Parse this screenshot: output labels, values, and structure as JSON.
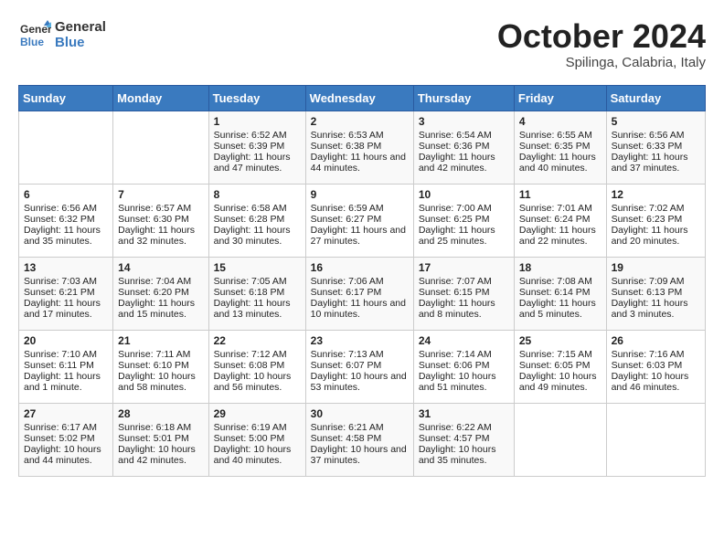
{
  "header": {
    "logo_line1": "General",
    "logo_line2": "Blue",
    "month": "October 2024",
    "location": "Spilinga, Calabria, Italy"
  },
  "days_of_week": [
    "Sunday",
    "Monday",
    "Tuesday",
    "Wednesday",
    "Thursday",
    "Friday",
    "Saturday"
  ],
  "weeks": [
    [
      {
        "day": "",
        "content": ""
      },
      {
        "day": "",
        "content": ""
      },
      {
        "day": "1",
        "content": "Sunrise: 6:52 AM\nSunset: 6:39 PM\nDaylight: 11 hours and 47 minutes."
      },
      {
        "day": "2",
        "content": "Sunrise: 6:53 AM\nSunset: 6:38 PM\nDaylight: 11 hours and 44 minutes."
      },
      {
        "day": "3",
        "content": "Sunrise: 6:54 AM\nSunset: 6:36 PM\nDaylight: 11 hours and 42 minutes."
      },
      {
        "day": "4",
        "content": "Sunrise: 6:55 AM\nSunset: 6:35 PM\nDaylight: 11 hours and 40 minutes."
      },
      {
        "day": "5",
        "content": "Sunrise: 6:56 AM\nSunset: 6:33 PM\nDaylight: 11 hours and 37 minutes."
      }
    ],
    [
      {
        "day": "6",
        "content": "Sunrise: 6:56 AM\nSunset: 6:32 PM\nDaylight: 11 hours and 35 minutes."
      },
      {
        "day": "7",
        "content": "Sunrise: 6:57 AM\nSunset: 6:30 PM\nDaylight: 11 hours and 32 minutes."
      },
      {
        "day": "8",
        "content": "Sunrise: 6:58 AM\nSunset: 6:28 PM\nDaylight: 11 hours and 30 minutes."
      },
      {
        "day": "9",
        "content": "Sunrise: 6:59 AM\nSunset: 6:27 PM\nDaylight: 11 hours and 27 minutes."
      },
      {
        "day": "10",
        "content": "Sunrise: 7:00 AM\nSunset: 6:25 PM\nDaylight: 11 hours and 25 minutes."
      },
      {
        "day": "11",
        "content": "Sunrise: 7:01 AM\nSunset: 6:24 PM\nDaylight: 11 hours and 22 minutes."
      },
      {
        "day": "12",
        "content": "Sunrise: 7:02 AM\nSunset: 6:23 PM\nDaylight: 11 hours and 20 minutes."
      }
    ],
    [
      {
        "day": "13",
        "content": "Sunrise: 7:03 AM\nSunset: 6:21 PM\nDaylight: 11 hours and 17 minutes."
      },
      {
        "day": "14",
        "content": "Sunrise: 7:04 AM\nSunset: 6:20 PM\nDaylight: 11 hours and 15 minutes."
      },
      {
        "day": "15",
        "content": "Sunrise: 7:05 AM\nSunset: 6:18 PM\nDaylight: 11 hours and 13 minutes."
      },
      {
        "day": "16",
        "content": "Sunrise: 7:06 AM\nSunset: 6:17 PM\nDaylight: 11 hours and 10 minutes."
      },
      {
        "day": "17",
        "content": "Sunrise: 7:07 AM\nSunset: 6:15 PM\nDaylight: 11 hours and 8 minutes."
      },
      {
        "day": "18",
        "content": "Sunrise: 7:08 AM\nSunset: 6:14 PM\nDaylight: 11 hours and 5 minutes."
      },
      {
        "day": "19",
        "content": "Sunrise: 7:09 AM\nSunset: 6:13 PM\nDaylight: 11 hours and 3 minutes."
      }
    ],
    [
      {
        "day": "20",
        "content": "Sunrise: 7:10 AM\nSunset: 6:11 PM\nDaylight: 11 hours and 1 minute."
      },
      {
        "day": "21",
        "content": "Sunrise: 7:11 AM\nSunset: 6:10 PM\nDaylight: 10 hours and 58 minutes."
      },
      {
        "day": "22",
        "content": "Sunrise: 7:12 AM\nSunset: 6:08 PM\nDaylight: 10 hours and 56 minutes."
      },
      {
        "day": "23",
        "content": "Sunrise: 7:13 AM\nSunset: 6:07 PM\nDaylight: 10 hours and 53 minutes."
      },
      {
        "day": "24",
        "content": "Sunrise: 7:14 AM\nSunset: 6:06 PM\nDaylight: 10 hours and 51 minutes."
      },
      {
        "day": "25",
        "content": "Sunrise: 7:15 AM\nSunset: 6:05 PM\nDaylight: 10 hours and 49 minutes."
      },
      {
        "day": "26",
        "content": "Sunrise: 7:16 AM\nSunset: 6:03 PM\nDaylight: 10 hours and 46 minutes."
      }
    ],
    [
      {
        "day": "27",
        "content": "Sunrise: 6:17 AM\nSunset: 5:02 PM\nDaylight: 10 hours and 44 minutes."
      },
      {
        "day": "28",
        "content": "Sunrise: 6:18 AM\nSunset: 5:01 PM\nDaylight: 10 hours and 42 minutes."
      },
      {
        "day": "29",
        "content": "Sunrise: 6:19 AM\nSunset: 5:00 PM\nDaylight: 10 hours and 40 minutes."
      },
      {
        "day": "30",
        "content": "Sunrise: 6:21 AM\nSunset: 4:58 PM\nDaylight: 10 hours and 37 minutes."
      },
      {
        "day": "31",
        "content": "Sunrise: 6:22 AM\nSunset: 4:57 PM\nDaylight: 10 hours and 35 minutes."
      },
      {
        "day": "",
        "content": ""
      },
      {
        "day": "",
        "content": ""
      }
    ]
  ]
}
